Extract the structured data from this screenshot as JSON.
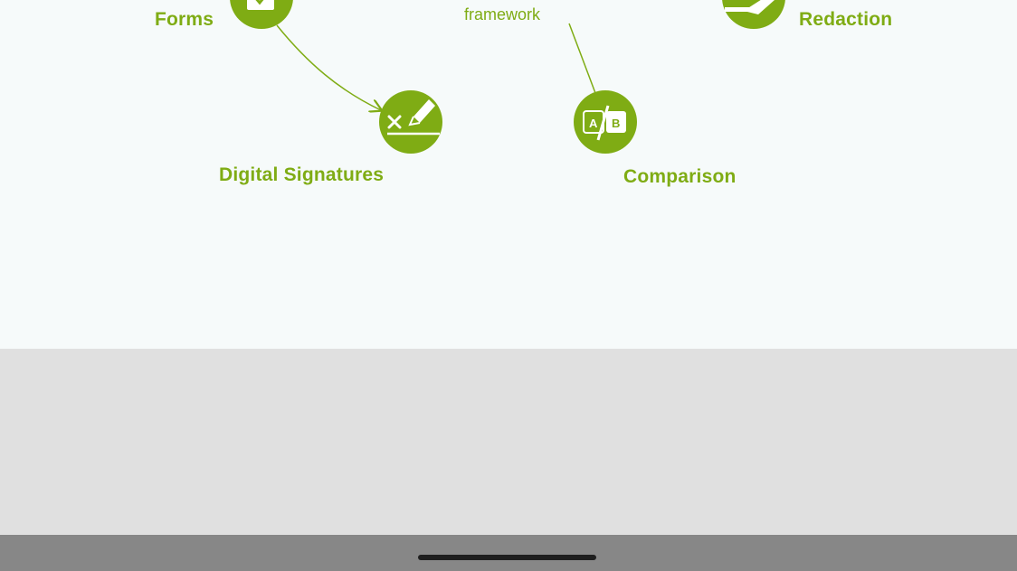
{
  "diagram": {
    "labels": {
      "forms": "Forms",
      "redaction": "Redaction",
      "digital_signatures": "Digital Signatures",
      "comparison": "Comparison"
    },
    "annotation": "framework",
    "comparison_icon": {
      "a": "A",
      "b": "B"
    }
  },
  "colors": {
    "accent": "#7fac14",
    "content_bg": "#f6fafa",
    "gray_area": "#e0e0e0",
    "bottom_bar": "#878787"
  },
  "icons": [
    "form-checkbox-icon",
    "redaction-icon",
    "signature-icon",
    "comparison-icon"
  ]
}
